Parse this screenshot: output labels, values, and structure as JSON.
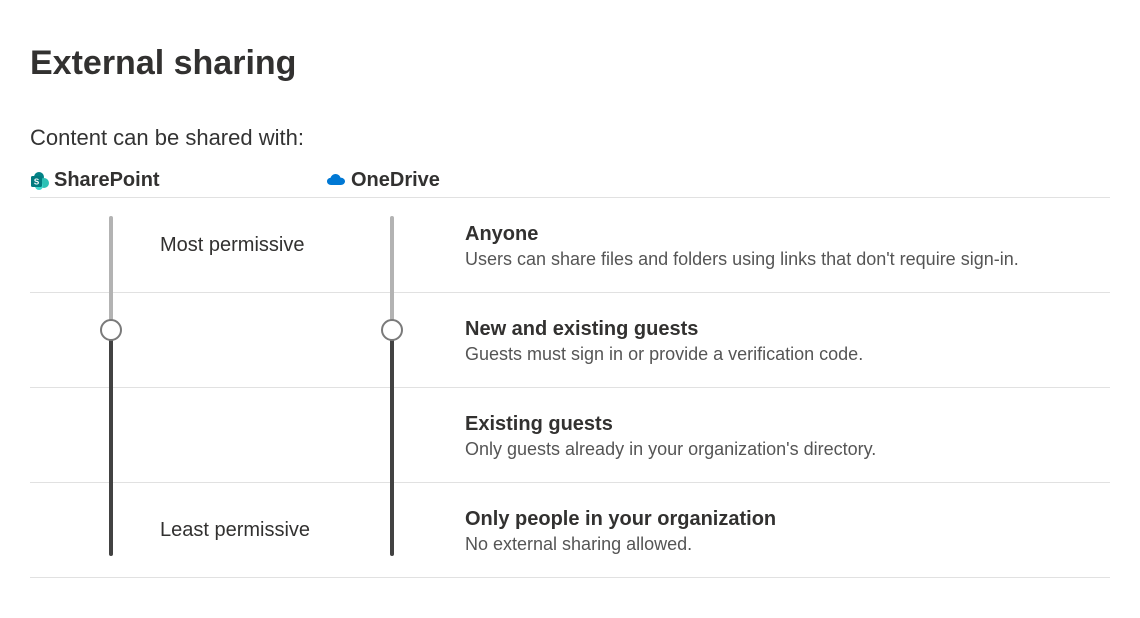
{
  "page": {
    "title": "External sharing",
    "subtitle": "Content can be shared with:"
  },
  "columns": {
    "sharepoint": {
      "label": "SharePoint"
    },
    "onedrive": {
      "label": "OneDrive"
    }
  },
  "legend": {
    "top": "Most permissive",
    "bottom": "Least permissive"
  },
  "options": [
    {
      "title": "Anyone",
      "sub": "Users can share files and folders using links that don't require sign-in."
    },
    {
      "title": "New and existing guests",
      "sub": "Guests must sign in or provide a verification code."
    },
    {
      "title": "Existing guests",
      "sub": "Only guests already in your organization's directory."
    },
    {
      "title": "Only people in your organization",
      "sub": "No external sharing allowed."
    }
  ],
  "sliders": {
    "sharepoint_index": 1,
    "onedrive_index": 1,
    "colors": {
      "track_above": "#b3b3b3",
      "track_below": "#424242",
      "handle_border": "#7a7a7a"
    }
  },
  "brand_colors": {
    "sharepoint": "#038387",
    "onedrive": "#0078d4"
  }
}
